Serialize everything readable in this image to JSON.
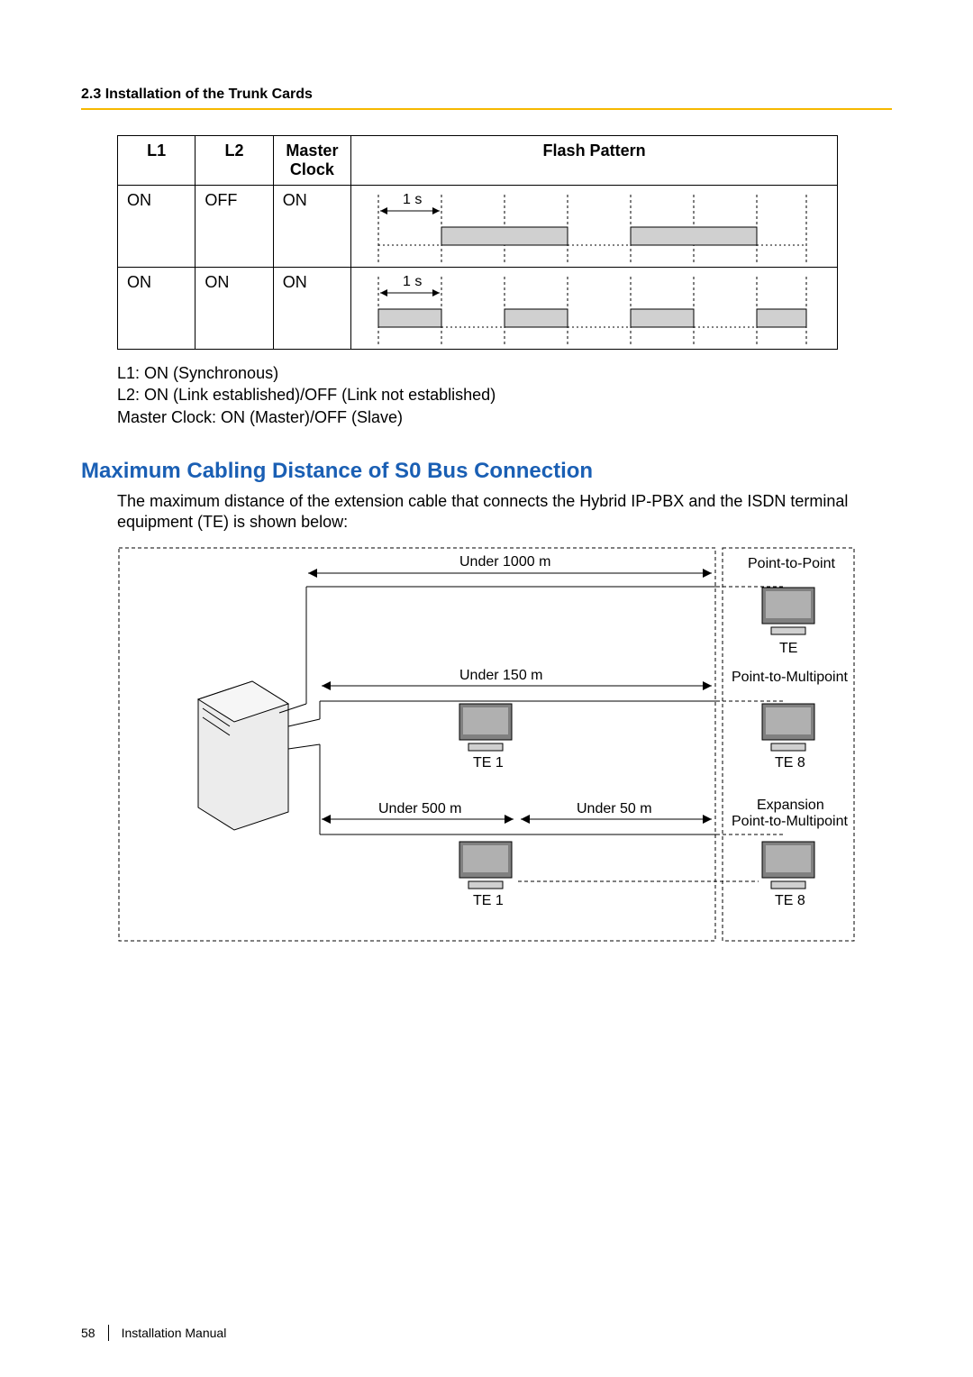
{
  "section_header": "2.3 Installation of the Trunk Cards",
  "table": {
    "headers": {
      "l1": "L1",
      "l2": "L2",
      "mc": "Master Clock",
      "fp": "Flash Pattern"
    },
    "rows": [
      {
        "l1": "ON",
        "l2": "OFF",
        "mc": "ON",
        "one_s": "1 s"
      },
      {
        "l1": "ON",
        "l2": "ON",
        "mc": "ON",
        "one_s": "1 s"
      }
    ]
  },
  "notes": {
    "n1": "L1: ON (Synchronous)",
    "n2": "L2: ON (Link established)/OFF (Link not established)",
    "n3": "Master Clock: ON (Master)/OFF (Slave)"
  },
  "heading_blue": "Maximum Cabling Distance of S0 Bus Connection",
  "body": "The maximum distance of the extension cable that connects the Hybrid IP-PBX and the ISDN terminal equipment (TE) is shown below:",
  "diagram": {
    "u1000": "Under 1000 m",
    "p2p": "Point-to-Point",
    "te": "TE",
    "u150": "Under 150 m",
    "p2m": "Point-to-Multipoint",
    "te1": "TE 1",
    "te8": "TE 8",
    "u500": "Under 500 m",
    "u50": "Under 50 m",
    "exp1": "Expansion",
    "exp2": "Point-to-Multipoint"
  },
  "footer": {
    "page": "58",
    "title": "Installation Manual"
  }
}
